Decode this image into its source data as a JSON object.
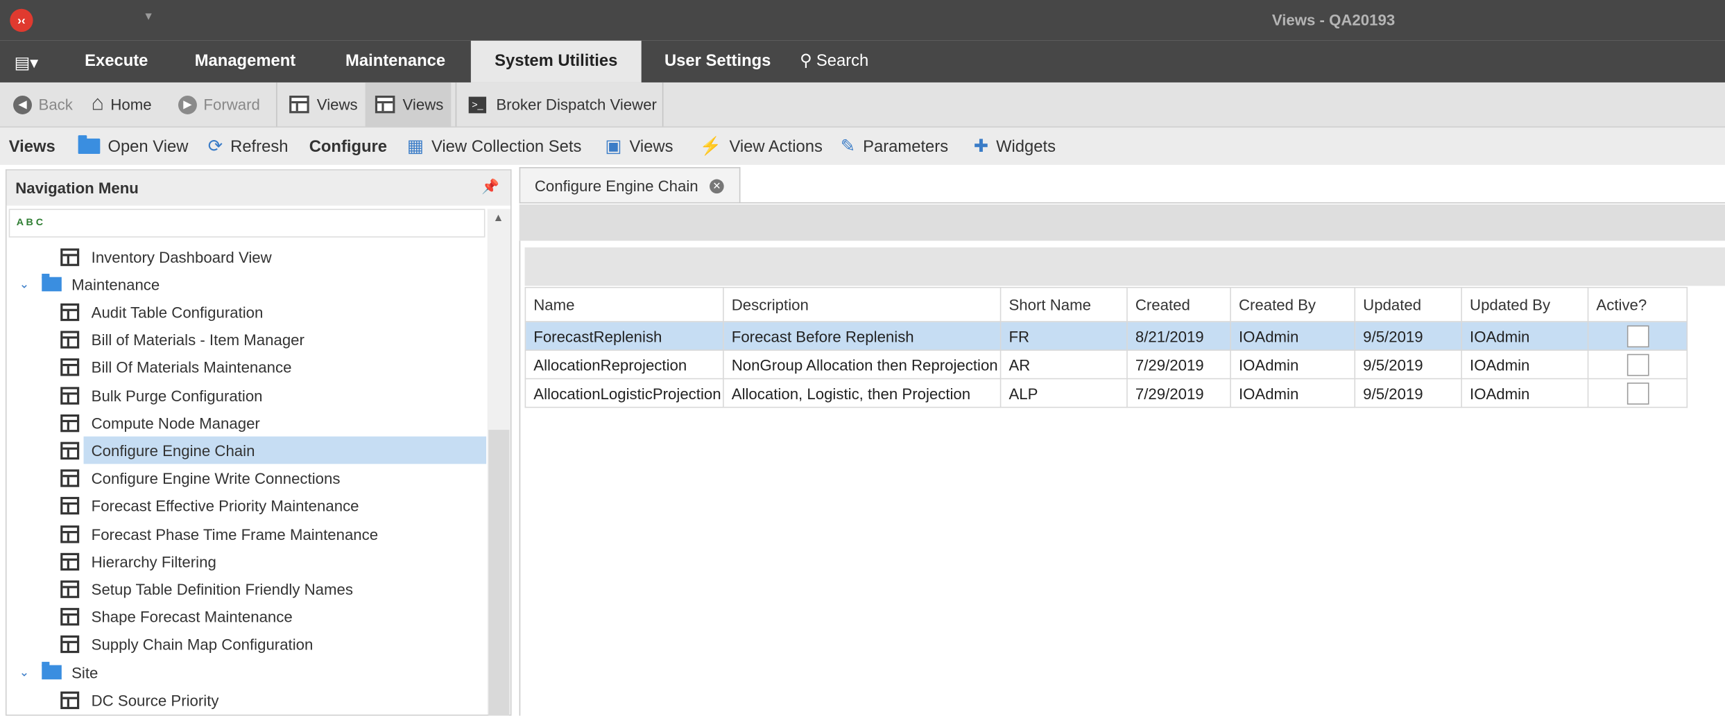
{
  "window": {
    "title": "Views - QA20193"
  },
  "ribbon": {
    "tabs": [
      {
        "label": "Execute"
      },
      {
        "label": "Management"
      },
      {
        "label": "Maintenance"
      },
      {
        "label": "System Utilities",
        "active": true
      },
      {
        "label": "User Settings"
      }
    ],
    "search_label": "Search"
  },
  "navbar": {
    "back": "Back",
    "home": "Home",
    "forward": "Forward",
    "views1": "Views",
    "views2": "Views",
    "broker": "Broker Dispatch Viewer"
  },
  "cmdbar": {
    "views_section": "Views",
    "open_view": "Open View",
    "refresh": "Refresh",
    "configure_section": "Configure",
    "view_collection_sets": "View Collection Sets",
    "views": "Views",
    "view_actions": "View Actions",
    "parameters": "Parameters",
    "widgets": "Widgets"
  },
  "nav_menu": {
    "title": "Navigation Menu",
    "filter_icon": "abc-filter-icon",
    "items": [
      {
        "type": "view",
        "label": "Inventory Dashboard View"
      },
      {
        "type": "folder",
        "label": "Maintenance"
      },
      {
        "type": "view",
        "label": "Audit Table Configuration"
      },
      {
        "type": "view",
        "label": "Bill of Materials - Item Manager"
      },
      {
        "type": "view",
        "label": "Bill Of Materials Maintenance"
      },
      {
        "type": "view",
        "label": "Bulk Purge Configuration"
      },
      {
        "type": "view",
        "label": "Compute Node Manager"
      },
      {
        "type": "view",
        "label": "Configure Engine Chain",
        "selected": true
      },
      {
        "type": "view",
        "label": "Configure Engine Write Connections"
      },
      {
        "type": "view",
        "label": "Forecast Effective Priority Maintenance"
      },
      {
        "type": "view",
        "label": "Forecast Phase Time Frame Maintenance"
      },
      {
        "type": "view",
        "label": "Hierarchy Filtering"
      },
      {
        "type": "view",
        "label": "Setup Table Definition Friendly Names"
      },
      {
        "type": "view",
        "label": "Shape Forecast Maintenance"
      },
      {
        "type": "view",
        "label": "Supply Chain Map Configuration"
      },
      {
        "type": "folder",
        "label": "Site"
      },
      {
        "type": "view",
        "label": "DC Source Priority"
      }
    ]
  },
  "document": {
    "tab_label": "Configure Engine Chain",
    "columns": [
      "Name",
      "Description",
      "Short Name",
      "Created",
      "Created By",
      "Updated",
      "Updated By",
      "Active?"
    ],
    "rows": [
      {
        "name": "ForecastReplenish",
        "description": "Forecast Before Replenish",
        "short": "FR",
        "created": "8/21/2019",
        "created_by": "IOAdmin",
        "updated": "9/5/2019",
        "updated_by": "IOAdmin",
        "active": false,
        "selected": true
      },
      {
        "name": "AllocationReprojection",
        "description": "NonGroup Allocation then Reprojection",
        "short": "AR",
        "created": "7/29/2019",
        "created_by": "IOAdmin",
        "updated": "9/5/2019",
        "updated_by": "IOAdmin",
        "active": false
      },
      {
        "name": "AllocationLogisticProjection",
        "description": "Allocation, Logistic, then Projection",
        "short": "ALP",
        "created": "7/29/2019",
        "created_by": "IOAdmin",
        "updated": "9/5/2019",
        "updated_by": "IOAdmin",
        "active": false
      }
    ]
  },
  "colors": {
    "titlebar": "#474747",
    "selection": "#c6ddf3",
    "accent": "#3a8ee0",
    "logo": "#e03a2f"
  }
}
